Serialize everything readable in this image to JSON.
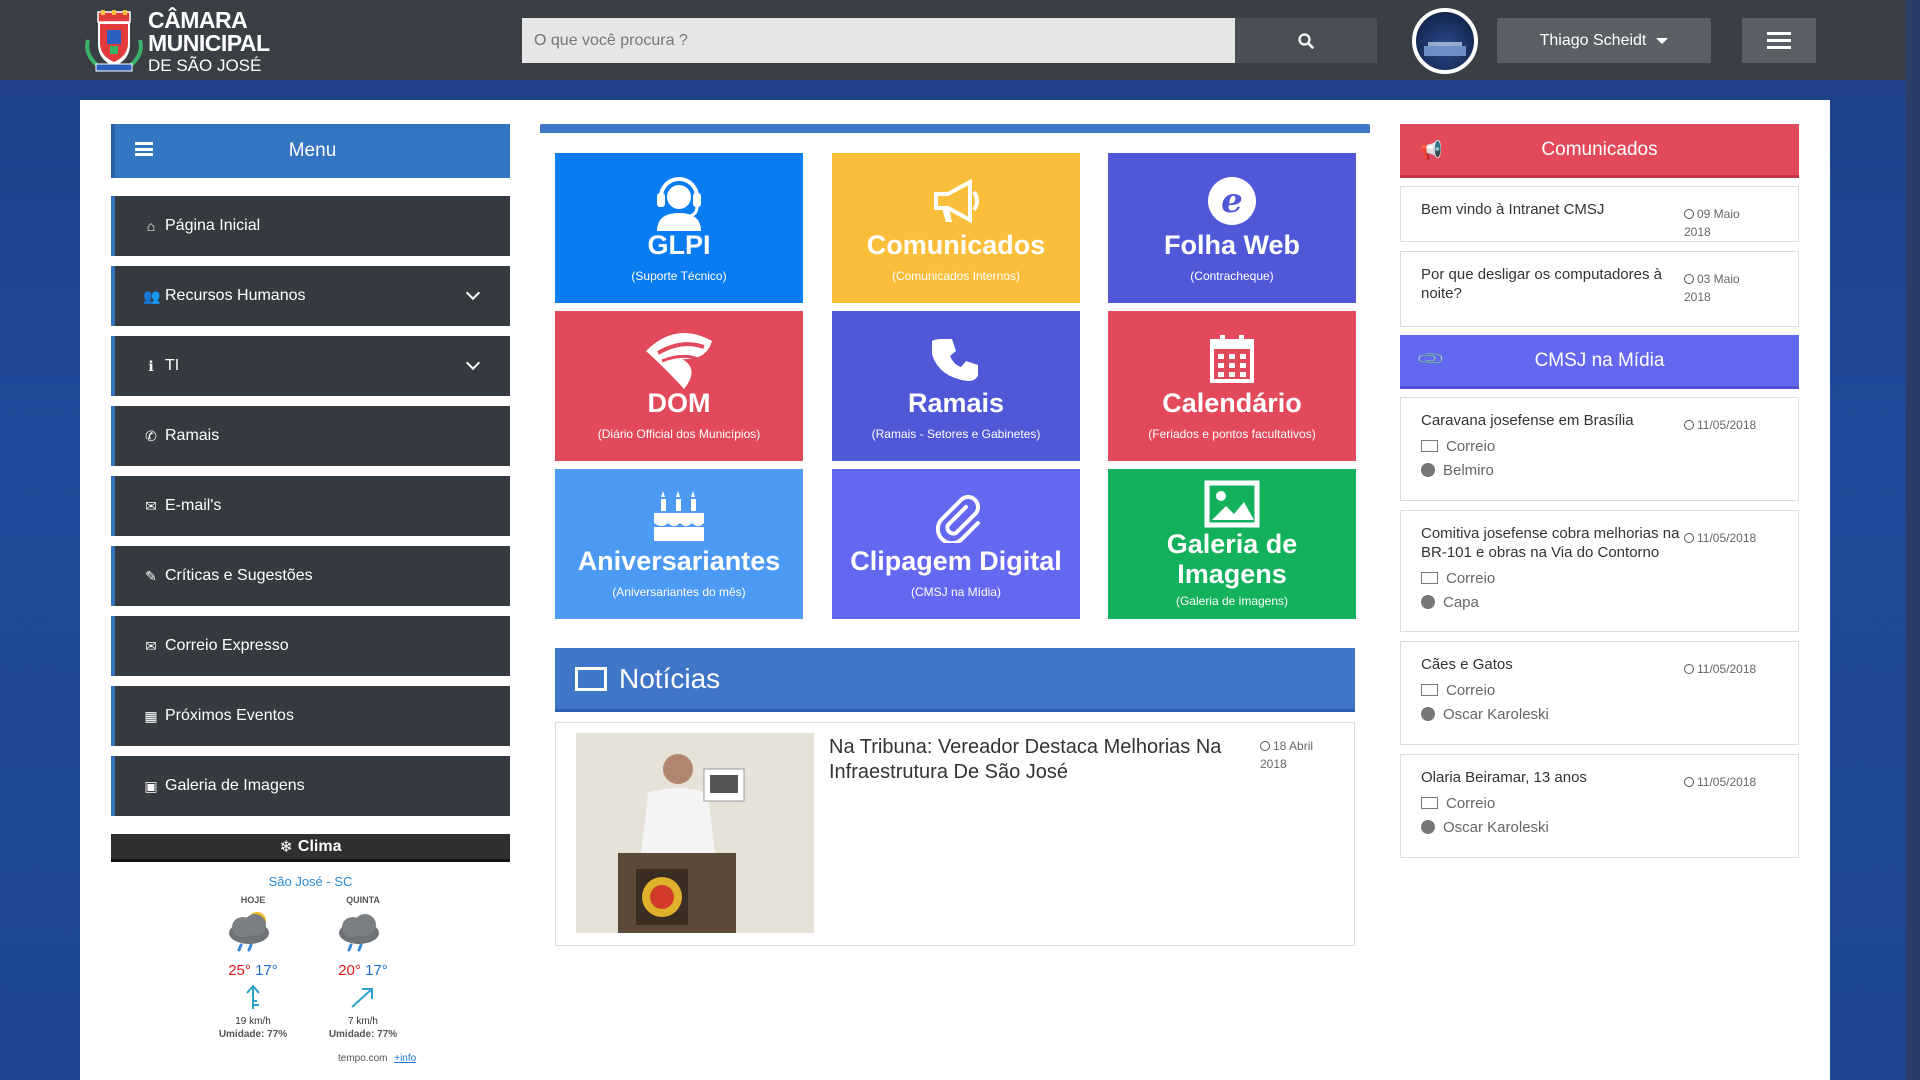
{
  "header": {
    "logo_line1": "CÂMARA MUNICIPAL",
    "logo_line2": "DE SÃO JOSÉ",
    "search_placeholder": "O que você procura ?",
    "user_name": "Thiago Scheidt"
  },
  "sidebar": {
    "menu_label": "Menu",
    "items": [
      {
        "label": "Página Inicial",
        "icon": "home-icon",
        "glyph": "⌂",
        "has_children": false
      },
      {
        "label": "Recursos Humanos",
        "icon": "users-icon",
        "glyph": "👥",
        "has_children": true
      },
      {
        "label": "TI",
        "icon": "info-icon",
        "glyph": "ℹ",
        "has_children": true
      },
      {
        "label": "Ramais",
        "icon": "phone-icon",
        "glyph": "✆",
        "has_children": false
      },
      {
        "label": "E-mail's",
        "icon": "envelope-icon",
        "glyph": "✉",
        "has_children": false
      },
      {
        "label": "Críticas e Sugestões",
        "icon": "edit-icon",
        "glyph": "✎",
        "has_children": false
      },
      {
        "label": "Correio Expresso",
        "icon": "envelope-icon",
        "glyph": "✉",
        "has_children": false
      },
      {
        "label": "Próximos Eventos",
        "icon": "calendar-icon",
        "glyph": "▦",
        "has_children": false
      },
      {
        "label": "Galeria de Imagens",
        "icon": "image-icon",
        "glyph": "▣",
        "has_children": false
      }
    ]
  },
  "weather": {
    "title": "Clima",
    "city": "São José - SC",
    "days": [
      {
        "day": "HOJE",
        "hi": "25°",
        "lo": "17°",
        "wind": "19 km/h",
        "humidity_label": "Umidade:",
        "humidity": "77%"
      },
      {
        "day": "QUINTA",
        "hi": "20°",
        "lo": "17°",
        "wind": "7 km/h",
        "humidity_label": "Umidade:",
        "humidity": "77%"
      }
    ],
    "source": "tempo.com",
    "more": "+info"
  },
  "tiles": [
    {
      "title": "GLPI",
      "sub": "(Suporte Técnico)",
      "color": "#0a7cf2",
      "icon": "headset-icon"
    },
    {
      "title": "Comunicados",
      "sub": "(Comunicados Internos)",
      "color": "#fbbe3b",
      "icon": "megaphone-icon"
    },
    {
      "title": "Folha Web",
      "sub": "(Contracheque)",
      "color": "#5158d8",
      "icon": "folha-logo-icon"
    },
    {
      "title": "DOM",
      "sub": "(Diário Official dos Municípios)",
      "color": "#e2495a",
      "icon": "dom-logo-icon"
    },
    {
      "title": "Ramais",
      "sub": "(Ramais - Setores e Gabinetes)",
      "color": "#5158d8",
      "icon": "phone-icon"
    },
    {
      "title": "Calendário",
      "sub": "(Feriados e pontos facultativos)",
      "color": "#e2495a",
      "icon": "calendar-icon"
    },
    {
      "title": "Aniversariantes",
      "sub": "(Aniversariantes do mês)",
      "color": "#4d9af4",
      "icon": "cake-icon"
    },
    {
      "title": "Clipagem Digital",
      "sub": "(CMSJ na Mídia)",
      "color": "#6467f0",
      "icon": "paperclip-icon"
    },
    {
      "title": "Galeria de Imagens",
      "sub": "(Galeria de imagens)",
      "color": "#13b15c",
      "icon": "picture-icon"
    }
  ],
  "news": {
    "title": "Notícias",
    "items": [
      {
        "headline": "Na Tribuna: Vereador Destaca Melhorias Na Infraestrutura De São José",
        "date_line1": "18 Abril",
        "date_line2": "2018"
      }
    ]
  },
  "comunicados": {
    "title": "Comunicados",
    "items": [
      {
        "title": "Bem vindo à Intranet CMSJ",
        "date_line1": "09 Maio 2018",
        "date_line2": ""
      },
      {
        "title": "Por que desligar os computadores à noite?",
        "date_line1": "03 Maio",
        "date_line2": "2018"
      }
    ]
  },
  "midia": {
    "title": "CMSJ na Mídia",
    "items": [
      {
        "title": "Caravana josefense em Brasília",
        "date": "11/05/2018",
        "source": "Correio",
        "author": "Belmiro"
      },
      {
        "title": "Comitiva josefense cobra melhorias na BR-101 e obras na Via do Contorno",
        "date": "11/05/2018",
        "source": "Correio",
        "author": "Capa"
      },
      {
        "title": "Cães e Gatos",
        "date": "11/05/2018",
        "source": "Correio",
        "author": "Oscar Karoleski"
      },
      {
        "title": "Olaria Beiramar, 13 anos",
        "date": "11/05/2018",
        "source": "Correio",
        "author": "Oscar Karoleski"
      }
    ]
  },
  "colors": {
    "topbar": "#3a3f45",
    "primary_blue": "#3375c0",
    "comunicados_red": "#e2495a",
    "midia_purple": "#6467f0",
    "sidebar_dark": "#353a40"
  }
}
